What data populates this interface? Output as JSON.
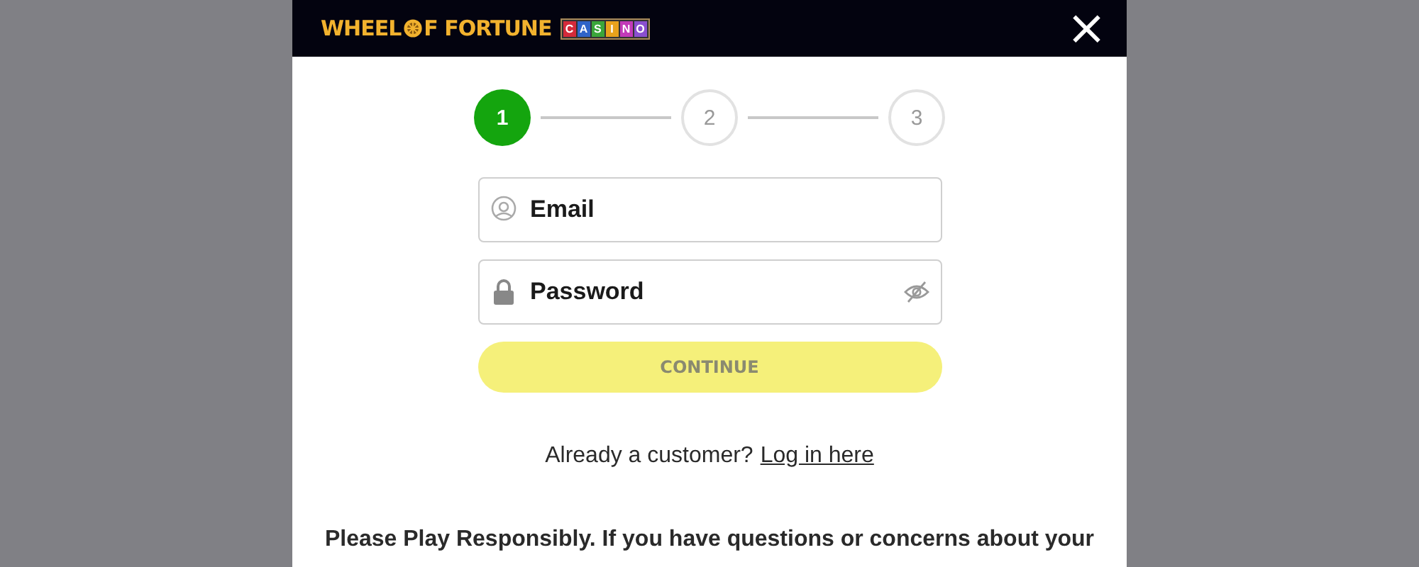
{
  "header": {
    "logo": {
      "before_wheel": "WHEEL",
      "after_wheel": "F FORTUNE",
      "badge": [
        {
          "letter": "C",
          "color": "#d42a3a"
        },
        {
          "letter": "A",
          "color": "#2f64c8"
        },
        {
          "letter": "S",
          "color": "#3aa63a"
        },
        {
          "letter": "I",
          "color": "#e8a21c"
        },
        {
          "letter": "N",
          "color": "#c23ab8"
        },
        {
          "letter": "O",
          "color": "#8a4fd0"
        }
      ]
    },
    "close": "×"
  },
  "steps": [
    {
      "label": "1",
      "selected": true
    },
    {
      "label": "2",
      "selected": false
    },
    {
      "label": "3",
      "selected": false
    }
  ],
  "fields": [
    {
      "kind": "email",
      "placeholder": "Email"
    },
    {
      "kind": "password",
      "placeholder": "Password"
    }
  ],
  "continue_button": {
    "label": "CONTINUE",
    "disabled": true
  },
  "login_prompt": {
    "text": "Already a customer?",
    "link": "Log in here"
  },
  "disclaimer": "Please Play Responsibly. If you have questions or concerns about your"
}
